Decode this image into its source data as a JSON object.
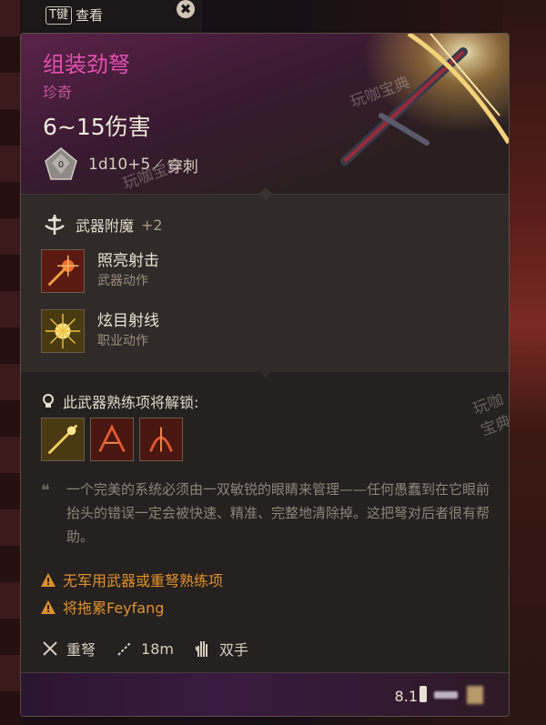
{
  "topbar": {
    "key": "T键",
    "label": "查看",
    "close_symbol": "✖"
  },
  "item": {
    "name": "组装劲弩",
    "rarity": "珍奇",
    "damage": "6~15伤害",
    "dice_roll": "1d10+5",
    "damage_type": "穿刺"
  },
  "enchant": {
    "title": "武器附魔",
    "bonus": "+2",
    "actions": [
      {
        "name": "照亮射击",
        "type": "武器动作",
        "icon": "flare-shot-icon"
      },
      {
        "name": "炫目射线",
        "type": "职业动作",
        "icon": "dazzling-ray-icon"
      }
    ]
  },
  "proficiency": {
    "title": "此武器熟练项将解锁:",
    "unlock_icons": [
      "piercing-shot-icon",
      "hamstring-shot-icon",
      "mobile-shot-icon"
    ]
  },
  "lore": "一个完美的系统必须由一双敏锐的眼睛来管理——任何愚蠢到在它眼前抬头的错误一定会被快速、精准、完整地清除掉。这把弩对后者很有帮助。",
  "warnings": [
    "无军用武器或重弩熟练项",
    "将拖累Feyfang"
  ],
  "tags": {
    "weapon_type": "重弩",
    "range": "18m",
    "handedness": "双手"
  },
  "footer": {
    "weight": "8.1"
  },
  "watermark": "玩咖宝典",
  "colors": {
    "rarity": "#e34fb0",
    "warning": "#e0902a",
    "frame": "#5a4c46"
  }
}
